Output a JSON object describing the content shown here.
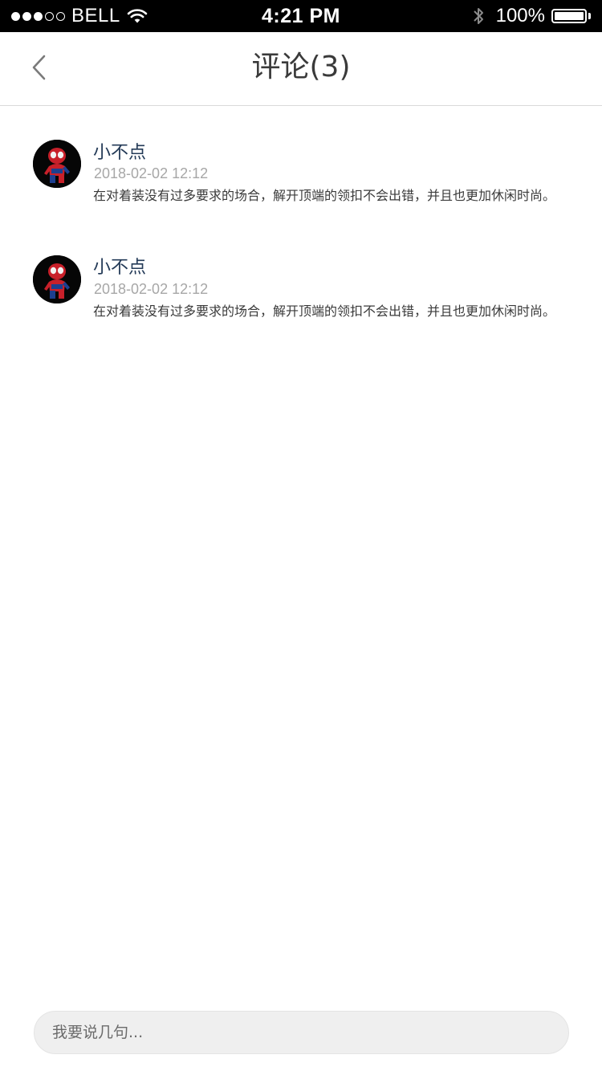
{
  "status_bar": {
    "signal_dots": [
      "on",
      "on",
      "on",
      "off",
      "off"
    ],
    "carrier": "BELL",
    "time": "4:21 PM",
    "battery_text": "100%",
    "battery_level": 1.0,
    "icons": [
      "wifi-icon",
      "bluetooth-icon",
      "battery-icon"
    ]
  },
  "nav": {
    "back_icon": "chevron-left-icon",
    "title": "评论(3)"
  },
  "comments": [
    {
      "name": "小不点",
      "time": "2018-02-02  12:12",
      "text": "在对着装没有过多要求的场合，解开顶端的领扣不会出错，并且也更加休闲时尚。",
      "avatar_icon": "spiderman-avatar"
    },
    {
      "name": "小不点",
      "time": "2018-02-02  12:12",
      "text": "在对着装没有过多要求的场合，解开顶端的领扣不会出错，并且也更加休闲时尚。",
      "avatar_icon": "spiderman-avatar"
    }
  ],
  "input": {
    "placeholder": "我要说几句...",
    "value": ""
  },
  "colors": {
    "name": "#233a57",
    "time": "#a7a7a7",
    "text": "#3a3a3a",
    "input_bg": "#efefef"
  }
}
